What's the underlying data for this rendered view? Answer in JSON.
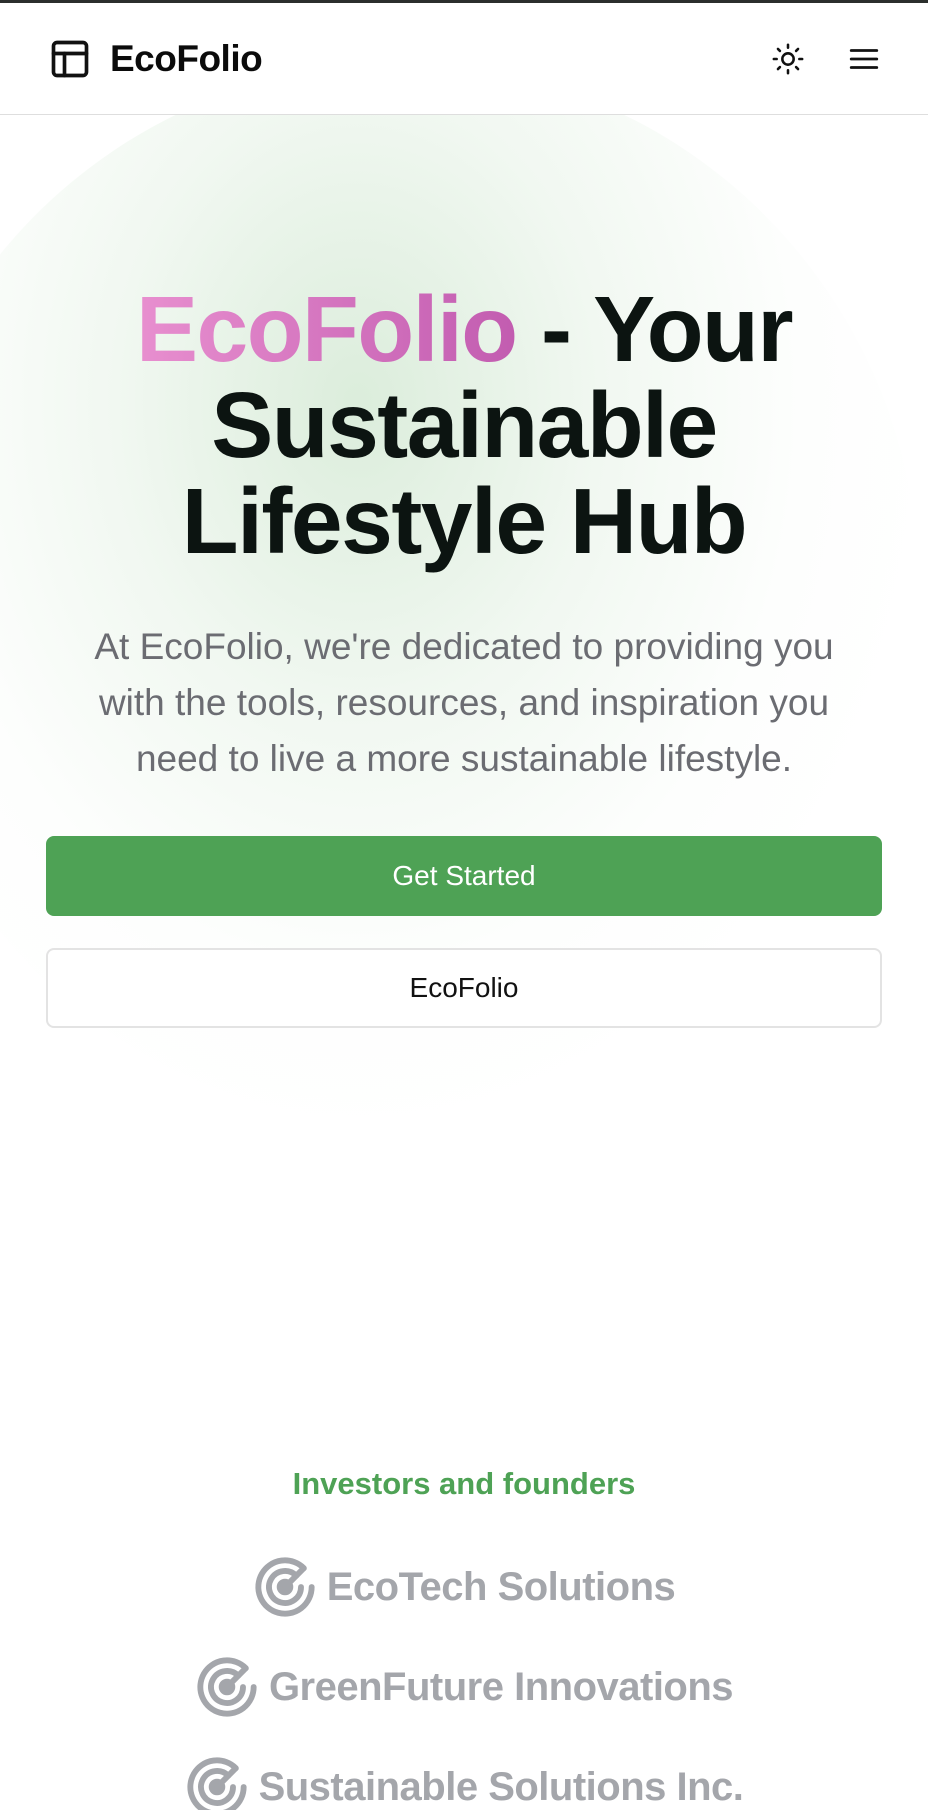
{
  "header": {
    "brand_name": "EcoFolio",
    "brand_icon": "layout-panel-icon",
    "theme_icon": "sun-icon",
    "menu_icon": "hamburger-menu-icon"
  },
  "hero": {
    "title_highlight": "EcoFolio",
    "title_rest": " - Your Sustainable Lifestyle Hub",
    "subtitle": "At EcoFolio, we're dedicated to providing you with the tools, resources, and inspiration you need to live a more sustainable lifestyle.",
    "primary_button": "Get Started",
    "secondary_button": "EcoFolio"
  },
  "investors": {
    "title": "Investors and founders",
    "items": [
      {
        "name": "EcoTech Solutions",
        "icon": "radar-target-icon"
      },
      {
        "name": "GreenFuture Innovations",
        "icon": "radar-target-icon"
      },
      {
        "name": "Sustainable Solutions Inc.",
        "icon": "radar-target-icon"
      }
    ]
  },
  "colors": {
    "accent_green": "#4ea255",
    "brand_gradient_start": "#e88fcf",
    "brand_gradient_end": "#c25cb0",
    "muted_text": "#6b6c72",
    "investor_gray": "#a4a6ab"
  }
}
